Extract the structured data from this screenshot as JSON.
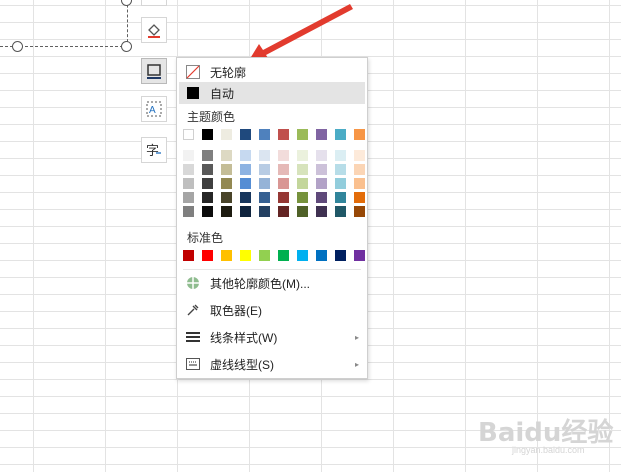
{
  "menu": {
    "no_outline": "无轮廓",
    "auto": "自动",
    "theme_colors_label": "主题颜色",
    "standard_colors_label": "标准色",
    "more_colors": "其他轮廓颜色(M)...",
    "eyedropper": "取色器(E)",
    "line_style": "线条样式(W)",
    "dash_type": "虚线线型(S)"
  },
  "theme_colors": {
    "base": [
      "#ffffff",
      "#000000",
      "#eeece1",
      "#1f497d",
      "#4f81bd",
      "#c0504d",
      "#9bbb59",
      "#8064a2",
      "#4bacc6",
      "#f79646"
    ],
    "shades": [
      [
        "#f2f2f2",
        "#7f7f7f",
        "#ddd9c3",
        "#c6d9f0",
        "#dbe5f1",
        "#f2dcdb",
        "#ebf1dd",
        "#e5e0ec",
        "#dbeef3",
        "#fdeada"
      ],
      [
        "#d8d8d8",
        "#595959",
        "#c4bd97",
        "#8db3e2",
        "#b8cce4",
        "#e5b9b7",
        "#d7e3bc",
        "#ccc1d9",
        "#b7dde8",
        "#fbd5b5"
      ],
      [
        "#bfbfbf",
        "#3f3f3f",
        "#938953",
        "#548dd4",
        "#95b3d7",
        "#d99694",
        "#c3d69b",
        "#b2a2c7",
        "#92cddc",
        "#fac08f"
      ],
      [
        "#a5a5a5",
        "#262626",
        "#494429",
        "#17365d",
        "#366092",
        "#953734",
        "#76923c",
        "#5f497a",
        "#31859b",
        "#e36c09"
      ],
      [
        "#7f7f7f",
        "#0c0c0c",
        "#1d1b10",
        "#0f243e",
        "#244061",
        "#632423",
        "#4f6128",
        "#3f3151",
        "#205867",
        "#974806"
      ]
    ]
  },
  "standard_colors": [
    "#c00000",
    "#ff0000",
    "#ffc000",
    "#ffff00",
    "#92d050",
    "#00b050",
    "#00b0f0",
    "#0070c0",
    "#002060",
    "#7030a0"
  ],
  "watermark": {
    "main": "Baidu经验",
    "sub": "jingyan.baidu.com"
  },
  "accent_color": "#e23b2e",
  "icons": [
    "fill-icon",
    "outline-icon",
    "text-effect-icon",
    "font-color-icon",
    "no-outline-icon",
    "eyedropper-icon",
    "line-style-icon",
    "dash-type-icon",
    "color-wheel-icon"
  ]
}
